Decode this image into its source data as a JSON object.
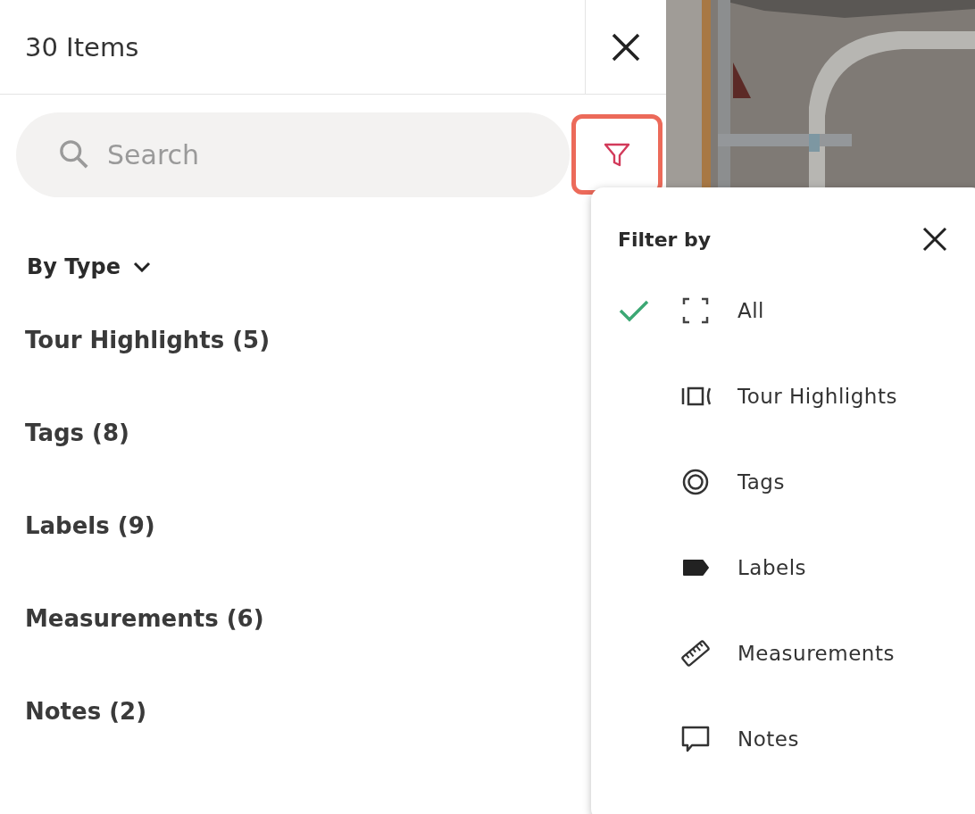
{
  "panel": {
    "title": "30 Items",
    "search": {
      "placeholder": "Search"
    },
    "filter_button": {
      "highlighted": true
    },
    "grouping": {
      "label": "By Type"
    },
    "groups": [
      {
        "label": "Tour Highlights (5)"
      },
      {
        "label": "Tags (8)"
      },
      {
        "label": "Labels (9)"
      },
      {
        "label": "Measurements (6)"
      },
      {
        "label": "Notes (2)"
      }
    ]
  },
  "filter_menu": {
    "title": "Filter by",
    "options": [
      {
        "label": "All",
        "kind": "all",
        "selected": true
      },
      {
        "label": "Tour Highlights",
        "kind": "highlights",
        "selected": false
      },
      {
        "label": "Tags",
        "kind": "tags",
        "selected": false
      },
      {
        "label": "Labels",
        "kind": "labels",
        "selected": false
      },
      {
        "label": "Measurements",
        "kind": "measurements",
        "selected": false
      },
      {
        "label": "Notes",
        "kind": "notes",
        "selected": false
      }
    ]
  }
}
